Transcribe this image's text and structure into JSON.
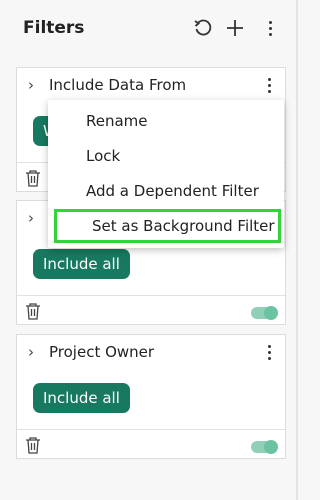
{
  "header": {
    "title": "Filters",
    "icons": [
      "reset-icon",
      "add-icon",
      "more-vertical-icon"
    ]
  },
  "cards": [
    {
      "title": "Include Data From",
      "pill": "W",
      "toggle_on": true
    },
    {
      "title": "",
      "pill": "Include all",
      "toggle_on": true
    },
    {
      "title": "Project Owner",
      "pill": "Include all",
      "toggle_on": true
    }
  ],
  "context_menu": {
    "items": [
      "Rename",
      "Lock",
      "Add a Dependent Filter",
      "Set as Background Filter"
    ],
    "highlighted": "Set as Background Filter"
  },
  "colors": {
    "accent": "#17795f",
    "toggle": "#6cc3a2",
    "highlight_border": "#35d33a"
  }
}
